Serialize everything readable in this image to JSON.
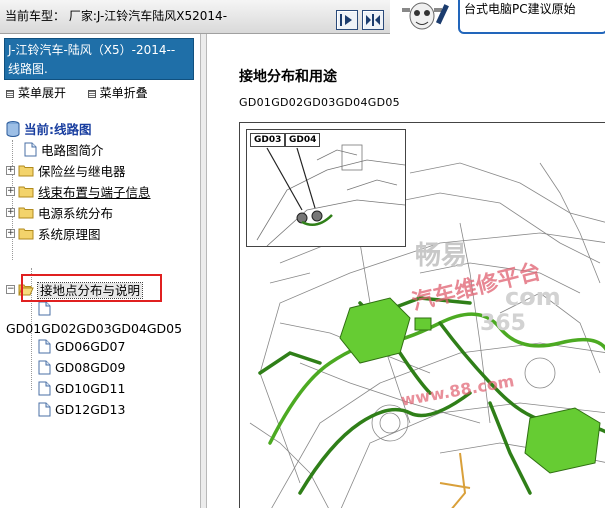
{
  "header": {
    "vehicle_label": "当前车型：  厂家:J-江铃汽车陆风X52014-",
    "banner_text": "台式电脑PC建议原始",
    "buttons": {
      "next": "next-icon",
      "fit": "fit-icon"
    }
  },
  "sidebar": {
    "doc_title": "J-江铃汽车-陆风（X5）-2014-- 线路图.",
    "menu_expand": "菜单展开",
    "menu_collapse": "菜单折叠",
    "tree": {
      "root": "当前:线路图",
      "items": [
        {
          "label": "电路图简介",
          "type": "doc"
        },
        {
          "label": "保险丝与继电器",
          "type": "folder"
        },
        {
          "label": "线束布置与端子信息",
          "type": "folder"
        },
        {
          "label": "电源系统分布",
          "type": "folder"
        },
        {
          "label": "系统原理图",
          "type": "folder"
        },
        {
          "label": "接地点分布与说明",
          "type": "folder-open"
        }
      ],
      "children": [
        {
          "label": "GD01GD02GD03GD04GD05"
        },
        {
          "label": "GD06GD07"
        },
        {
          "label": "GD08GD09"
        },
        {
          "label": "GD10GD11"
        },
        {
          "label": "GD12GD13"
        }
      ]
    }
  },
  "main": {
    "title": "接地分布和用途",
    "subtitle": "GD01GD02GD03GD04GD05",
    "inset_tags": [
      "GD03",
      "GD04"
    ],
    "watermark": {
      "line1": "畅易",
      "line2": "汽车维修平台",
      "line3": "com",
      "line4": "365",
      "line5": "www.88.com"
    }
  },
  "colors": {
    "header_blue": "#1f6fa8",
    "harness_green": "#66cc33",
    "highlight_red": "#e02020",
    "tree_root_blue": "#1a3fa0",
    "watermark_red": "#e06070"
  }
}
